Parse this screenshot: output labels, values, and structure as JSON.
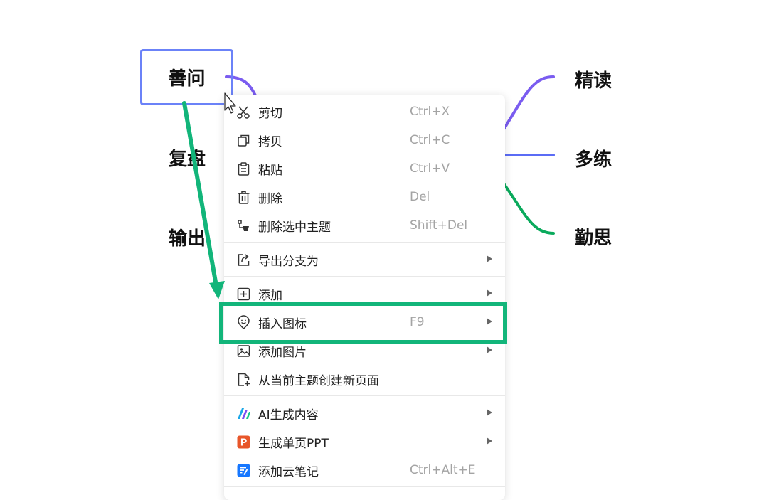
{
  "mindmap": {
    "left_nodes": [
      "善问",
      "复盘",
      "输出"
    ],
    "right_nodes": [
      "精读",
      "多练",
      "勤思"
    ],
    "colors": {
      "purple": "#7a5cf0",
      "blue": "#5b6cf5",
      "green": "#0aaa5c",
      "selection": "#6b82f8"
    }
  },
  "context_menu": {
    "items": [
      {
        "label": "剪切",
        "shortcut": "Ctrl+X",
        "icon": "scissors-icon"
      },
      {
        "label": "拷贝",
        "shortcut": "Ctrl+C",
        "icon": "copy-icon"
      },
      {
        "label": "粘贴",
        "shortcut": "Ctrl+V",
        "icon": "clipboard-icon"
      },
      {
        "label": "删除",
        "shortcut": "Del",
        "icon": "trash-icon"
      },
      {
        "label": "删除选中主题",
        "shortcut": "Shift+Del",
        "icon": "delete-topic-icon"
      },
      {
        "label": "导出分支为",
        "shortcut": "",
        "icon": "export-icon",
        "submenu": true
      },
      {
        "label": "添加",
        "shortcut": "",
        "icon": "plus-box-icon",
        "submenu": true
      },
      {
        "label": "插入图标",
        "shortcut": "F9",
        "icon": "smile-pin-icon",
        "submenu": true,
        "highlighted": true
      },
      {
        "label": "添加图片",
        "shortcut": "",
        "icon": "image-icon",
        "submenu": true
      },
      {
        "label": "从当前主题创建新页面",
        "shortcut": "",
        "icon": "new-page-icon"
      },
      {
        "label": "AI生成内容",
        "shortcut": "",
        "icon": "ai-logo-icon",
        "submenu": true
      },
      {
        "label": "生成单页PPT",
        "shortcut": "",
        "icon": "ppt-icon",
        "submenu": true
      },
      {
        "label": "添加云笔记",
        "shortcut": "Ctrl+Alt+E",
        "icon": "cloud-note-icon"
      }
    ]
  },
  "annotation": {
    "color": "#12b57a"
  }
}
